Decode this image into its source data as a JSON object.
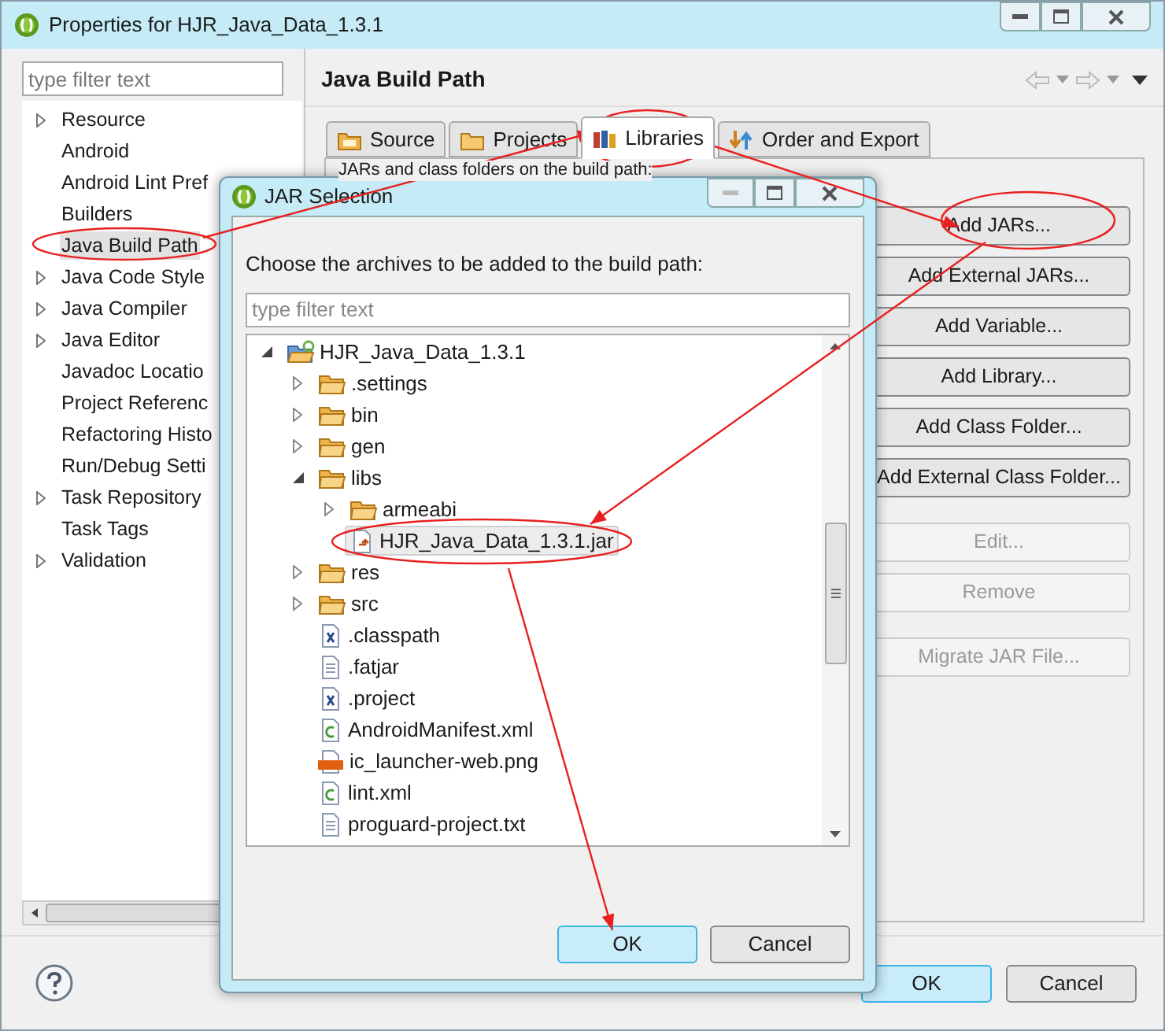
{
  "window": {
    "title": "Properties for HJR_Java_Data_1.3.1"
  },
  "sidebar": {
    "filter_placeholder": "type filter text",
    "items": [
      {
        "label": "Resource",
        "expandable": true,
        "selected": false
      },
      {
        "label": "Android",
        "expandable": false,
        "selected": false
      },
      {
        "label": "Android Lint Pref",
        "expandable": false,
        "selected": false
      },
      {
        "label": "Builders",
        "expandable": false,
        "selected": false
      },
      {
        "label": "Java Build Path",
        "expandable": false,
        "selected": true
      },
      {
        "label": "Java Code Style",
        "expandable": true,
        "selected": false
      },
      {
        "label": "Java Compiler",
        "expandable": true,
        "selected": false
      },
      {
        "label": "Java Editor",
        "expandable": true,
        "selected": false
      },
      {
        "label": "Javadoc Locatio",
        "expandable": false,
        "selected": false
      },
      {
        "label": "Project Referenc",
        "expandable": false,
        "selected": false
      },
      {
        "label": "Refactoring Histo",
        "expandable": false,
        "selected": false
      },
      {
        "label": "Run/Debug Setti",
        "expandable": false,
        "selected": false
      },
      {
        "label": "Task Repository",
        "expandable": true,
        "selected": false
      },
      {
        "label": "Task Tags",
        "expandable": false,
        "selected": false
      },
      {
        "label": "Validation",
        "expandable": true,
        "selected": false
      }
    ]
  },
  "page": {
    "title": "Java Build Path",
    "tabs": [
      {
        "label": "Source",
        "kind": "source",
        "selected": false
      },
      {
        "label": "Projects",
        "kind": "projects",
        "selected": false
      },
      {
        "label": "Libraries",
        "kind": "libraries",
        "selected": true
      },
      {
        "label": "Order and Export",
        "kind": "order",
        "selected": false
      }
    ],
    "description": "JARs and class folders on the build path:",
    "button_groups": [
      [
        {
          "label": "Add JARs...",
          "disabled": false
        },
        {
          "label": "Add External JARs...",
          "disabled": false
        },
        {
          "label": "Add Variable...",
          "disabled": false
        },
        {
          "label": "Add Library...",
          "disabled": false
        },
        {
          "label": "Add Class Folder...",
          "disabled": false
        },
        {
          "label": "Add External Class Folder...",
          "disabled": false
        }
      ],
      [
        {
          "label": "Edit...",
          "disabled": true
        },
        {
          "label": "Remove",
          "disabled": true
        }
      ],
      [
        {
          "label": "Migrate JAR File...",
          "disabled": true
        }
      ]
    ]
  },
  "dialog": {
    "title": "JAR Selection",
    "prompt": "Choose the archives to be added to the build path:",
    "filter_placeholder": "type filter text",
    "tree": [
      {
        "label": "HJR_Java_Data_1.3.1",
        "kind": "project",
        "expanded": true,
        "selected": false,
        "children": [
          {
            "label": ".settings",
            "kind": "folder",
            "expanded": false,
            "selected": false
          },
          {
            "label": "bin",
            "kind": "folder",
            "expanded": false,
            "selected": false
          },
          {
            "label": "gen",
            "kind": "folder",
            "expanded": false,
            "selected": false
          },
          {
            "label": "libs",
            "kind": "folder",
            "expanded": true,
            "selected": false,
            "children": [
              {
                "label": "armeabi",
                "kind": "folder",
                "expanded": false,
                "selected": false
              },
              {
                "label": "HJR_Java_Data_1.3.1.jar",
                "kind": "jar",
                "selected": true
              }
            ]
          },
          {
            "label": "res",
            "kind": "folder",
            "expanded": false,
            "selected": false
          },
          {
            "label": "src",
            "kind": "folder",
            "expanded": false,
            "selected": false
          },
          {
            "label": ".classpath",
            "kind": "xml",
            "selected": false
          },
          {
            "label": ".fatjar",
            "kind": "text",
            "selected": false
          },
          {
            "label": ".project",
            "kind": "xml",
            "selected": false
          },
          {
            "label": "AndroidManifest.xml",
            "kind": "android",
            "selected": false
          },
          {
            "label": "ic_launcher-web.png",
            "kind": "image",
            "selected": false
          },
          {
            "label": "lint.xml",
            "kind": "android",
            "selected": false
          },
          {
            "label": "proguard-project.txt",
            "kind": "text",
            "selected": false
          }
        ]
      }
    ],
    "buttons": [
      {
        "label": "OK",
        "default": true
      },
      {
        "label": "Cancel",
        "default": false
      }
    ]
  },
  "footer": {
    "buttons": [
      {
        "label": "OK",
        "default": true
      },
      {
        "label": "Cancel",
        "default": false
      }
    ]
  }
}
